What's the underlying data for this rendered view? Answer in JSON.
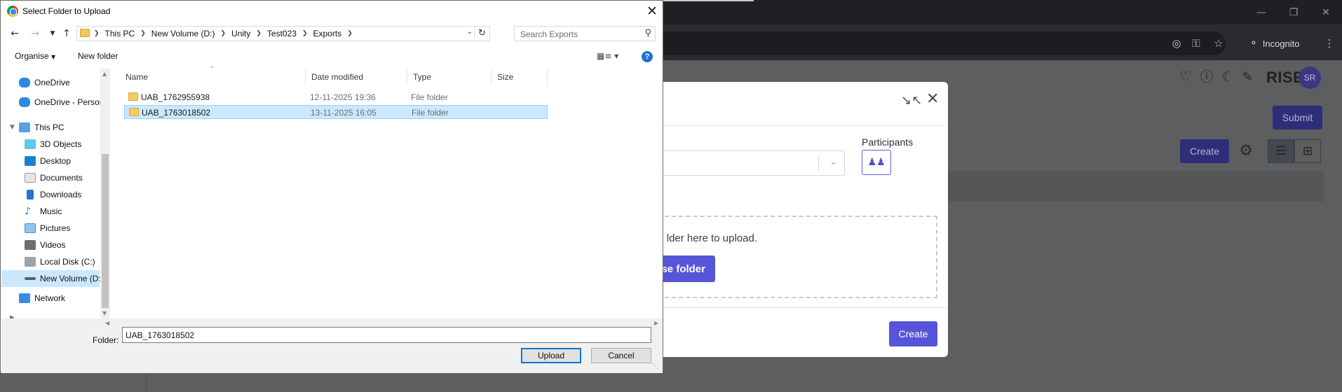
{
  "browser": {
    "incognito_label": "Incognito",
    "window_controls": [
      "minimize-icon",
      "restore-icon",
      "close-icon"
    ]
  },
  "webpage": {
    "brand": "RISE",
    "avatar_initials": "SR",
    "submit_label": "Submit",
    "create_label": "Create",
    "modal": {
      "participants_label": "Participants",
      "dropzone_text": "lder here to upload.",
      "choose_button_label": "se folder",
      "create_label": "Create"
    }
  },
  "dialog": {
    "title": "Select Folder to Upload",
    "breadcrumb": [
      "This PC",
      "New Volume (D:)",
      "Unity",
      "Test023",
      "Exports"
    ],
    "search_placeholder": "Search Exports",
    "toolbar": {
      "organise_label": "Organise",
      "new_folder_label": "New folder",
      "help_label": "?"
    },
    "nav_items": [
      {
        "label": "OneDrive",
        "icon": "onedrive-icon"
      },
      {
        "label": "OneDrive - Person",
        "icon": "onedrive-icon"
      },
      {
        "label": "This PC",
        "icon": "computer-icon"
      },
      {
        "label": "3D Objects",
        "icon": "3d-objects-icon"
      },
      {
        "label": "Desktop",
        "icon": "desktop-icon"
      },
      {
        "label": "Documents",
        "icon": "documents-icon"
      },
      {
        "label": "Downloads",
        "icon": "downloads-icon"
      },
      {
        "label": "Music",
        "icon": "music-icon"
      },
      {
        "label": "Pictures",
        "icon": "pictures-icon"
      },
      {
        "label": "Videos",
        "icon": "videos-icon"
      },
      {
        "label": "Local Disk (C:)",
        "icon": "disk-icon"
      },
      {
        "label": "New Volume (D:",
        "icon": "drive-icon"
      },
      {
        "label": "Network",
        "icon": "network-icon"
      }
    ],
    "columns": [
      "Name",
      "Date modified",
      "Type",
      "Size"
    ],
    "files": [
      {
        "name": "UAB_1762955938",
        "modified": "12-11-2025 19:36",
        "type": "File folder",
        "size": ""
      },
      {
        "name": "UAB_1763018502",
        "modified": "13-11-2025 16:05",
        "type": "File folder",
        "size": ""
      }
    ],
    "folder_label": "Folder:",
    "folder_value": "UAB_1763018502",
    "upload_label": "Upload",
    "cancel_label": "Cancel"
  }
}
